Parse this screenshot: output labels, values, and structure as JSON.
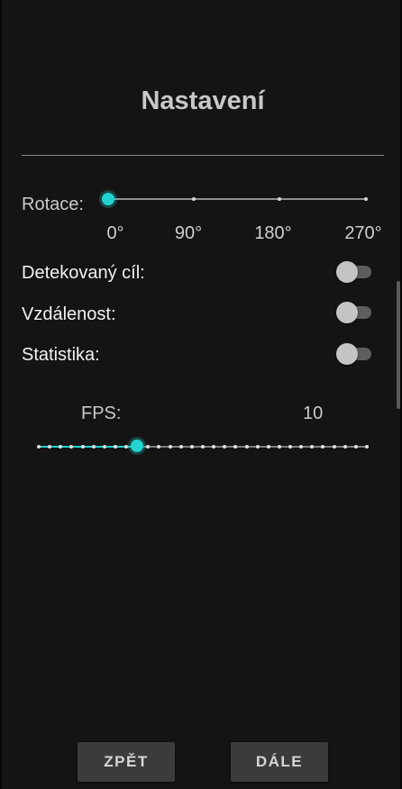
{
  "title": "Nastavení",
  "rotation": {
    "label": "Rotace:",
    "ticks": [
      "0°",
      "90°",
      "180°",
      "270°"
    ],
    "selected": "0°"
  },
  "toggles": [
    {
      "label": "Detekovaný cíl:",
      "on": false
    },
    {
      "label": "Vzdálenost:",
      "on": false
    },
    {
      "label": "Statistika:",
      "on": false
    }
  ],
  "fps": {
    "label": "FPS:",
    "value": "10"
  },
  "buttons": {
    "back": "ZPĚT",
    "next": "DÁLE"
  },
  "colors": {
    "accent": "#22d3cf",
    "background": "#141414",
    "button": "#3b3b3b"
  }
}
